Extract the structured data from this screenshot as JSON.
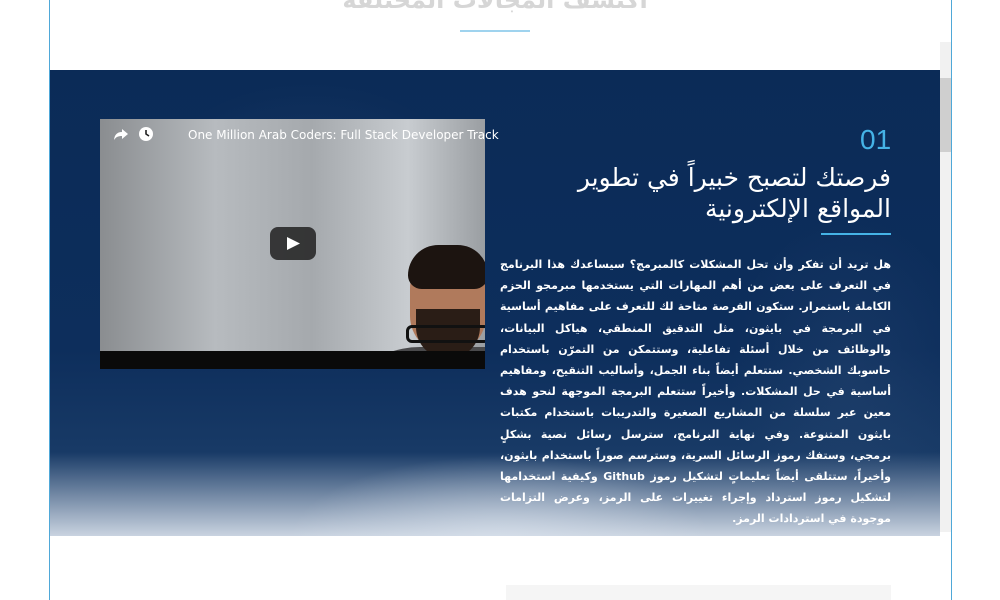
{
  "section": {
    "heading": "اكتشف المجالات المختلفة"
  },
  "track": {
    "number": "01",
    "title": "فرصتك لتصبح خبيراً في تطوير المواقع الإلكترونية",
    "description": "هل تريد أن تفكر وأن تحل المشكلات كالمبرمج؟ سيساعدك هذا البرنامج في التعرف على بعض من أهم المهارات التي يستخدمها مبرمجو الحزم الكاملة باستمرار. ستكون الفرصة متاحة لك للتعرف على مفاهيم أساسية في البرمجة في بايثون، مثل التدقيق المنطقي، هياكل البيانات، والوظائف من خلال أسئلة تفاعلية، وستتمكن من التمرّن باستخدام حاسوبك الشخصي. ستتعلم أيضاً بناء الجمل، وأساليب التنقيح، ومفاهيم أساسية في حل المشكلات. وأخيراً ستتعلم البرمجة الموجهة لنحو هدف معين عبر سلسلة من المشاريع الصغيرة والتدريبات باستخدام مكتبات بايثون المتنوعة. وفي نهاية البرنامج، سترسل رسائل نصية بشكلٍ برمجي، وستفك رموز الرسائل السرية، وسترسم صوراً باستخدام بايثون، وأخيراً، ستتلقى أيضاً تعليماتٍ لتشكيل رموز Github وكيفية استخدامها لتشكيل رموز استرداد وإجراء تغييرات على الرمز، وعرض التزامات موجودة في استردادات الرمز."
  },
  "video": {
    "title": "One Million Arab Coders: Full Stack Developer Track",
    "icons": [
      "share-icon",
      "watch-later-icon",
      "play-icon"
    ]
  },
  "colors": {
    "accent": "#45b3e6",
    "hero_background": "#0d2e5c",
    "frame_border": "#4fa8d8"
  }
}
